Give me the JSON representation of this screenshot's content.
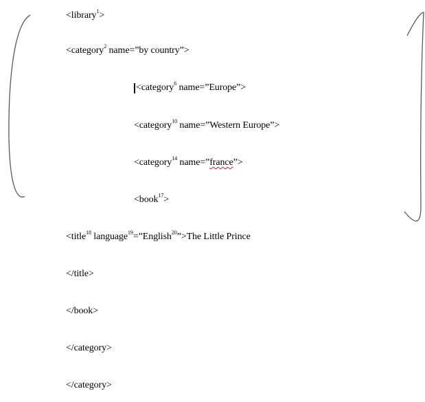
{
  "document": {
    "lines": [
      {
        "tag": "<library",
        "sup": "1",
        "rest": ">",
        "end": ""
      },
      {
        "tag": "<category",
        "sup": "2",
        "rest": " name=”by country”>",
        "end": ""
      },
      {
        "tag": "<category",
        "sup": "6",
        "rest": " name=”Europe”>",
        "end": ""
      },
      {
        "tag": "<category",
        "sup": "10",
        "rest": " name=”Western Europe”>",
        "end": ""
      },
      {
        "tag": "<category",
        "sup": "14",
        "rest": " name=”",
        "mis": "france",
        "end": "”>"
      },
      {
        "tag": "<book",
        "sup": "17",
        "rest": ">",
        "end": ""
      },
      {
        "tag": "<title",
        "sup": "18",
        "rest": " language",
        "sup2": "19",
        "rest2": "=”English",
        "sup3": "20",
        "rest3": "”>The Little Prince"
      },
      {
        "text": "</title>"
      },
      {
        "text": "</book>"
      },
      {
        "text": "</category>"
      },
      {
        "text": "</category>"
      }
    ]
  },
  "colors": {
    "text": "#000000",
    "spellcheck": "#e0141e",
    "bracket": "#595959"
  }
}
